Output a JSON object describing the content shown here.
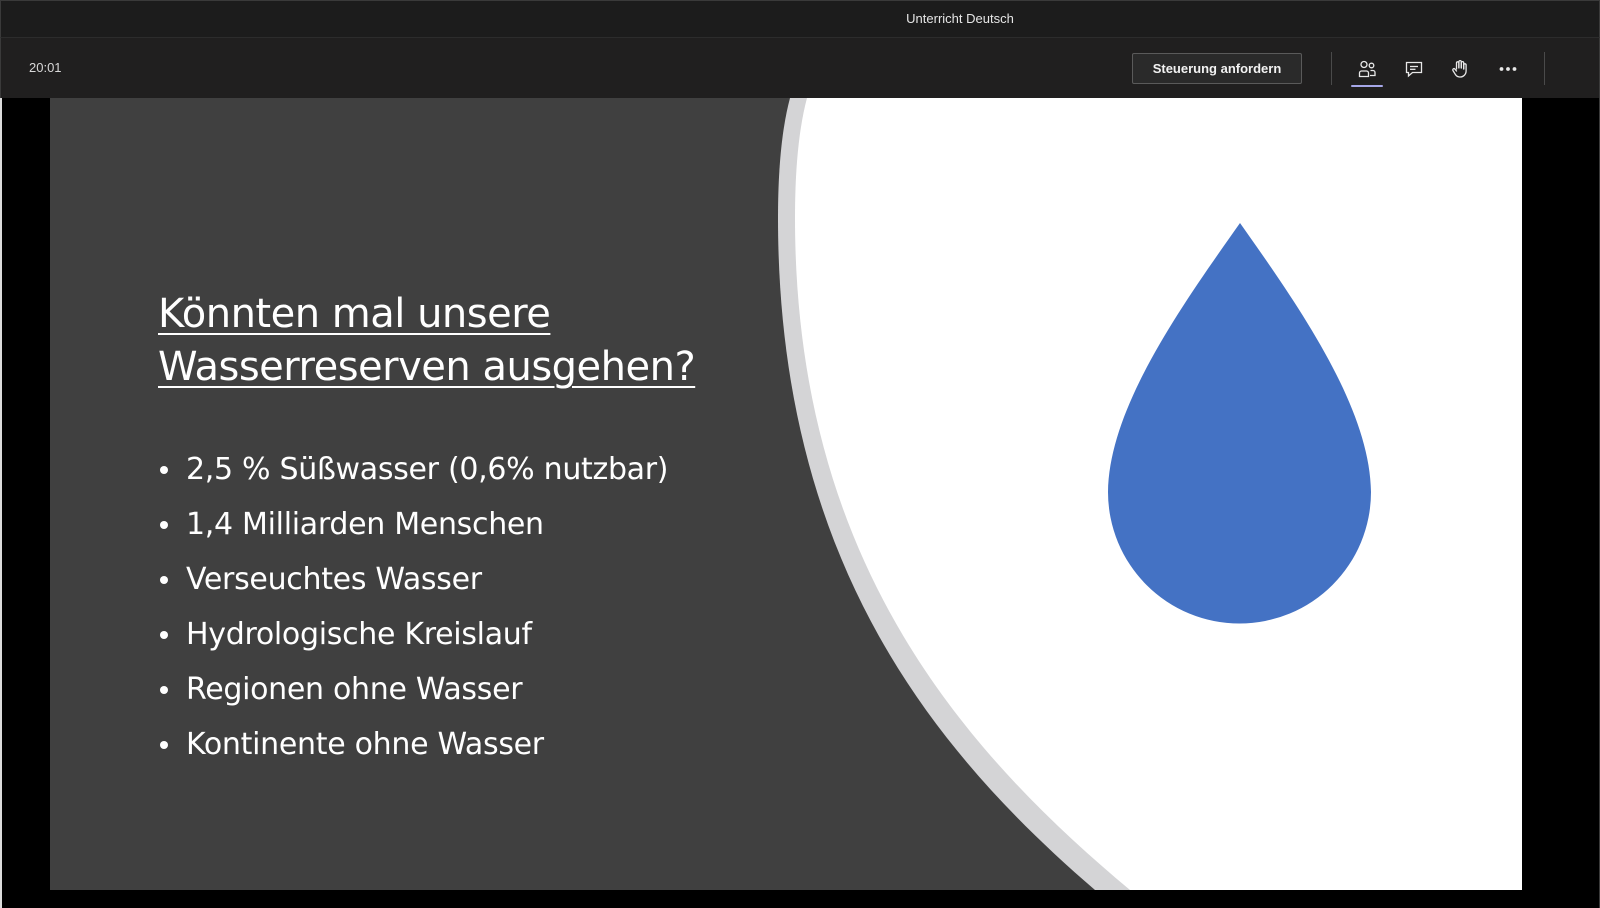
{
  "window": {
    "title": "Unterricht Deutsch"
  },
  "toolbar": {
    "timer": "20:01",
    "request_control_label": "Steuerung anfordern",
    "icons": {
      "participants": "participants-icon",
      "chat": "chat-icon",
      "raise_hand": "raise-hand-icon",
      "more": "more-options-icon"
    }
  },
  "slide": {
    "title_line1": "Könnten mal unsere",
    "title_line2": "Wasserreserven ausgehen?",
    "bullets": [
      "2,5 % Süßwasser (0,6% nutzbar)",
      "1,4 Milliarden Menschen",
      "Verseuchtes Wasser",
      "Hydrologische Kreislauf",
      "Regionen ohne Wasser",
      "Kontinente ohne Wasser"
    ],
    "image": "water-drop",
    "colors": {
      "background": "#404040",
      "panel": "#ffffff",
      "arc": "#d4d4d6",
      "drop": "#4472c4",
      "text": "#ffffff"
    }
  },
  "colors": {
    "accent": "#a6a7e8",
    "toolbar_bg": "#201f1f",
    "titlebar_bg": "#1c1c1c"
  }
}
